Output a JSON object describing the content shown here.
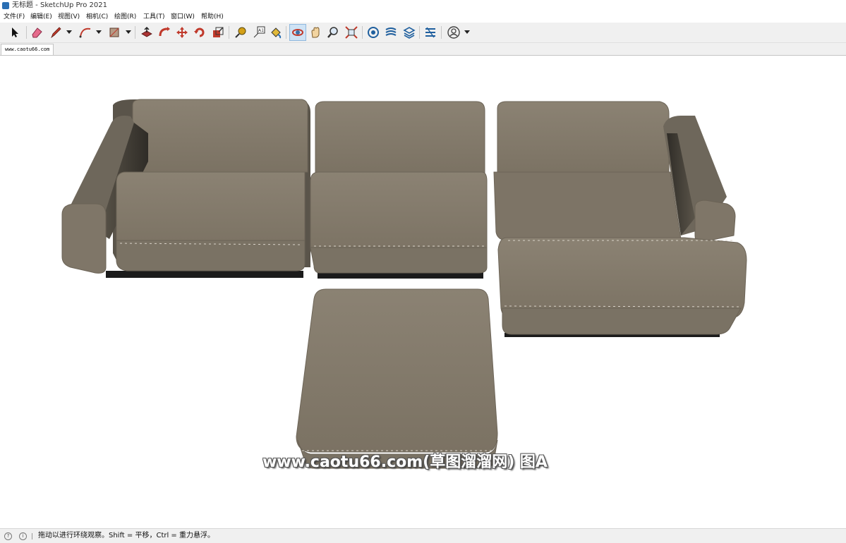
{
  "window": {
    "title": "无标题 - SketchUp Pro 2021",
    "icon": "sketchup-logo-icon"
  },
  "menu": {
    "items": [
      "文件(F)",
      "编辑(E)",
      "视图(V)",
      "相机(C)",
      "绘图(R)",
      "工具(T)",
      "窗口(W)",
      "帮助(H)"
    ]
  },
  "toolbar": {
    "tools": [
      "select-arrow-icon",
      "eraser-icon",
      "pencil-line-icon",
      "arc-icon",
      "rectangle-icon",
      "push-pull-icon",
      "follow-me-icon",
      "move-icon",
      "rotate-icon",
      "scale-icon",
      "tape-measure-icon",
      "text-icon",
      "paint-bucket-icon",
      "orbit-icon",
      "pan-icon",
      "zoom-icon",
      "zoom-extents-icon",
      "3d-warehouse-icon",
      "extension-warehouse-icon",
      "layout-icon",
      "extension-manager-icon",
      "account-icon"
    ],
    "active_tool": "orbit-icon"
  },
  "scene_tabs": [
    "www.caotu66.com"
  ],
  "model": {
    "description_colors": {
      "fabric": "#847a6b",
      "fabric_dark": "#4a453c",
      "base": "#1b1b1b"
    }
  },
  "watermark": {
    "text": "www.caotu66.com(草图溜溜网) 图A"
  },
  "status": {
    "icons": [
      "geo-location-icon",
      "info-icon"
    ],
    "message": "拖动以进行环绕观察。Shift = 平移，Ctrl = 重力悬浮。"
  }
}
